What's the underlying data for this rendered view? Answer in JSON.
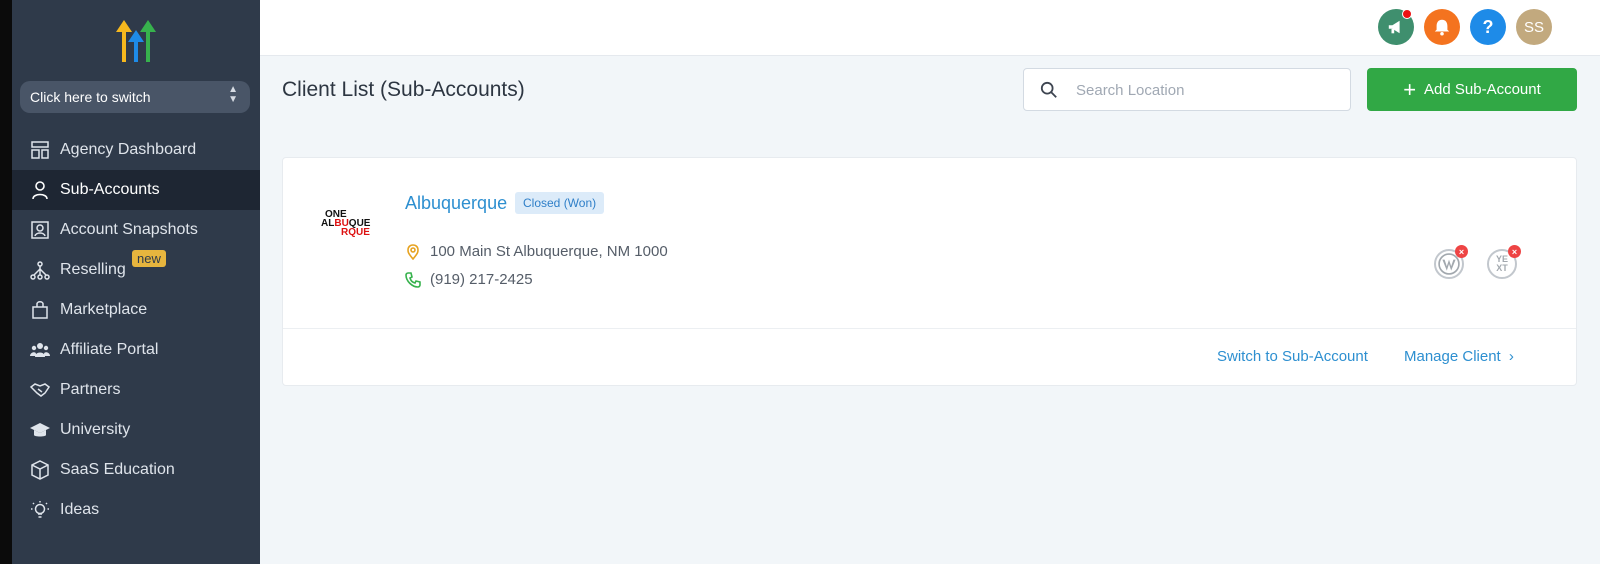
{
  "sidebar": {
    "switcher_label": "Click here to switch",
    "items": [
      {
        "label": "Agency Dashboard",
        "icon": "dashboard-icon"
      },
      {
        "label": "Sub-Accounts",
        "icon": "user-icon",
        "active": true
      },
      {
        "label": "Account Snapshots",
        "icon": "snapshot-icon"
      },
      {
        "label": "Reselling",
        "icon": "network-icon",
        "badge": "new"
      },
      {
        "label": "Marketplace",
        "icon": "bag-icon"
      },
      {
        "label": "Affiliate Portal",
        "icon": "users-icon"
      },
      {
        "label": "Partners",
        "icon": "handshake-icon"
      },
      {
        "label": "University",
        "icon": "graduation-cap-icon"
      },
      {
        "label": "SaaS Education",
        "icon": "cube-icon"
      },
      {
        "label": "Ideas",
        "icon": "lightbulb-icon"
      }
    ]
  },
  "topbar": {
    "avatar_initials": "SS",
    "help_symbol": "?",
    "colors": {
      "announce": "#3f8f6e",
      "notify": "#f4731f",
      "help": "#1e8be8",
      "avatar": "#c2a97e"
    }
  },
  "page": {
    "title": "Client List (Sub-Accounts)",
    "search_placeholder": "Search Location",
    "add_button": "Add Sub-Account"
  },
  "client": {
    "logo_line1": "ONE",
    "logo_line2a": "AL",
    "logo_line2b": "BU",
    "logo_line2c": "QUE",
    "logo_line3": "RQUE",
    "name": "Albuquerque",
    "status": "Closed (Won)",
    "address": "100 Main St Albuquerque, NM 1000",
    "phone": "(919) 217-2425",
    "integration_yext": "YE XT",
    "switch_link": "Switch to Sub-Account",
    "manage_link": "Manage Client"
  },
  "colors": {
    "sidebar": "#2f3a4a",
    "accent_green": "#31a845",
    "link_blue": "#2d8fd0"
  }
}
